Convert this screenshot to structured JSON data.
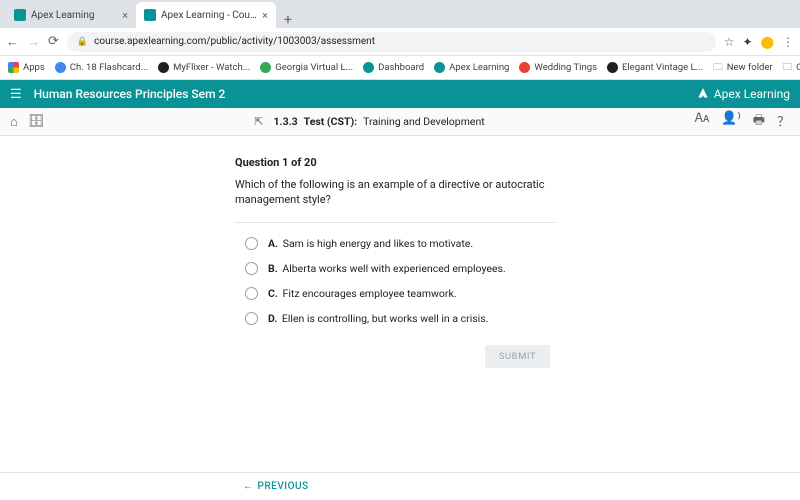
{
  "browser": {
    "tabs": [
      {
        "title": "Apex Learning",
        "active": false
      },
      {
        "title": "Apex Learning - Courses",
        "active": true
      }
    ],
    "url": "course.apexlearning.com/public/activity/1003003/assessment",
    "bookmarks": [
      {
        "label": "Apps",
        "color": "grid"
      },
      {
        "label": "Ch. 18 Flashcard...",
        "color": "#4285f4"
      },
      {
        "label": "MyFlixer - Watch...",
        "color": "#212121"
      },
      {
        "label": "Georgia Virtual L...",
        "color": "#34a853"
      },
      {
        "label": "Dashboard",
        "color": "#0a9396"
      },
      {
        "label": "Apex Learning",
        "color": "#0a9396"
      },
      {
        "label": "Wedding Tings",
        "color": "#ea4335"
      },
      {
        "label": "Elegant Vintage L...",
        "color": "#212121"
      },
      {
        "label": "New folder",
        "color": "folder"
      },
      {
        "label": "Clothing style",
        "color": "folder"
      }
    ]
  },
  "app": {
    "course_title": "Human Resources Principles Sem 2",
    "brand": "Apex Learning",
    "breadcrumb_code": "1.3.3",
    "breadcrumb_type": "Test (CST):",
    "breadcrumb_title": "Training and Development"
  },
  "quiz": {
    "question_label": "Question 1 of 20",
    "question_text": "Which of the following is an example of a directive or autocratic management style?",
    "options": [
      {
        "letter": "A.",
        "text": "Sam is high energy and likes to motivate."
      },
      {
        "letter": "B.",
        "text": "Alberta works well with experienced employees."
      },
      {
        "letter": "C.",
        "text": "Fitz encourages employee teamwork."
      },
      {
        "letter": "D.",
        "text": "Ellen is controlling, but works well in a crisis."
      }
    ],
    "submit_label": "SUBMIT",
    "previous_label": "PREVIOUS"
  }
}
